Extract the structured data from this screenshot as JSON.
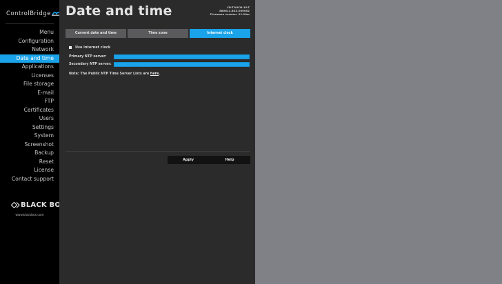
{
  "sidebar": {
    "logo_text": "ControlBridge",
    "menu": [
      {
        "label": "Menu"
      },
      {
        "label": "Configuration"
      },
      {
        "label": "Network"
      },
      {
        "label": "Date and time",
        "active": true
      },
      {
        "label": "Applications"
      },
      {
        "label": "Licenses"
      },
      {
        "label": "File storage"
      },
      {
        "label": "E-mail"
      },
      {
        "label": "FTP"
      },
      {
        "label": "Certificates"
      },
      {
        "label": "Users"
      },
      {
        "label": "Settings"
      },
      {
        "label": "System"
      },
      {
        "label": "Screenshot"
      },
      {
        "label": "Backup"
      },
      {
        "label": "Reset"
      },
      {
        "label": "License"
      },
      {
        "label": "Contact support"
      }
    ],
    "brand": "BLACK BOX",
    "brand_url": "www.blackbox.com"
  },
  "header": {
    "title": "Date and time",
    "device_model": "CB-TOUCH-10-T",
    "device_serial": "880611.BS5.000002",
    "firmware": "Firmware version: 21.20m"
  },
  "tabs": [
    {
      "label": "Current date and time"
    },
    {
      "label": "Time zone"
    },
    {
      "label": "Internet clock",
      "active": true
    }
  ],
  "form": {
    "use_internet_clock_label": "Use internet clock",
    "use_internet_clock_checked": false,
    "primary_label": "Primary NTP server:",
    "primary_value": "",
    "secondary_label": "Secondary NTP server:",
    "secondary_value": "",
    "note_prefix": "Note: The Public NTP Time Server Lists are ",
    "note_link": "here",
    "note_suffix": "."
  },
  "actions": {
    "apply_label": "Apply",
    "help_label": "Help"
  },
  "colors": {
    "accent": "#1aa3e8",
    "sidebar_bg": "#000000",
    "panel_bg": "#2b2b2c",
    "page_bg": "#808186"
  }
}
